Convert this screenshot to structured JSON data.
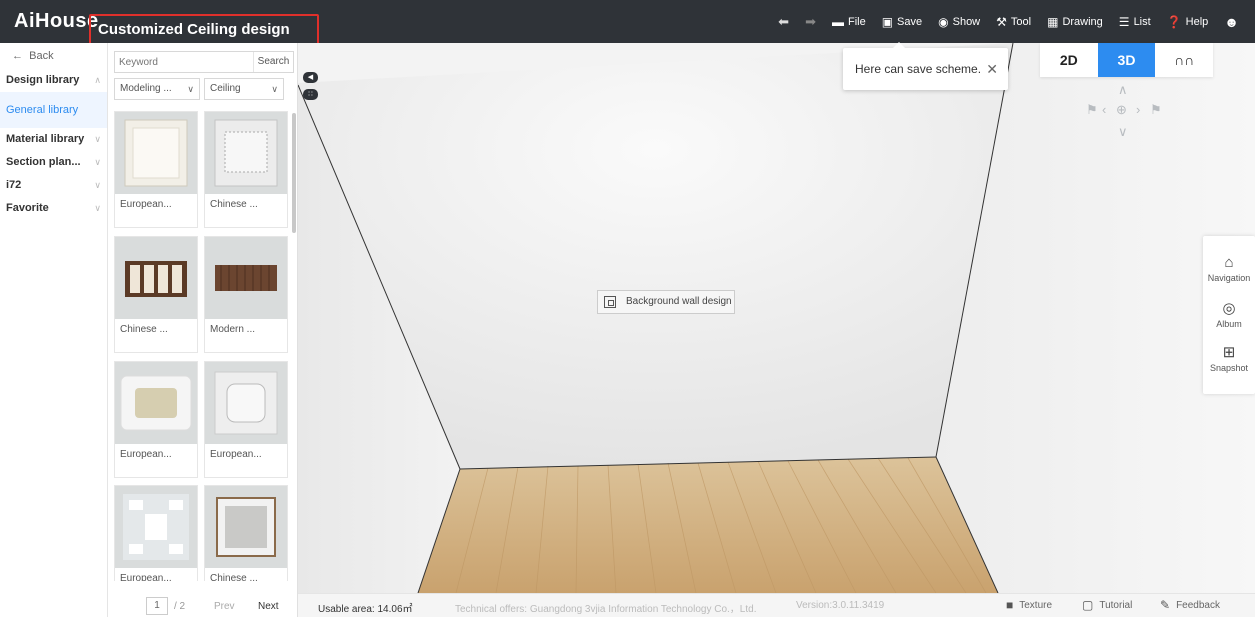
{
  "header": {
    "logo_text": "AiHouse",
    "page_title": "Customized Ceiling design",
    "toolbar": {
      "file": "File",
      "save": "Save",
      "show": "Show",
      "tool": "Tool",
      "drawing": "Drawing",
      "list": "List",
      "help": "Help"
    }
  },
  "sidebar": {
    "back": "Back",
    "design_library": "Design library",
    "general_library": "General library",
    "material_library": "Material library",
    "section_plan": "Section plan...",
    "i72": "i72",
    "favorite": "Favorite"
  },
  "library": {
    "search_placeholder": "Keyword",
    "search_button": "Search",
    "filter_type": "Modeling ...",
    "filter_category": "Ceiling",
    "items": [
      {
        "label": "European..."
      },
      {
        "label": "Chinese ..."
      },
      {
        "label": "Chinese ..."
      },
      {
        "label": "Modern ..."
      },
      {
        "label": "European..."
      },
      {
        "label": "European..."
      },
      {
        "label": "European..."
      },
      {
        "label": "Chinese ..."
      }
    ],
    "pager": {
      "current": "1",
      "total": "/ 2",
      "prev": "Prev",
      "next": "Next"
    }
  },
  "viewport": {
    "tooltip": "Here can save scheme.",
    "view_tabs": [
      "2D",
      "3D",
      "ΩΩ"
    ],
    "active_view": "3D",
    "background_wall_button": "Background wall design"
  },
  "right_panel": {
    "navigation": "Navigation",
    "album": "Album",
    "snapshot": "Snapshot"
  },
  "status_bar": {
    "usable_area": "Usable area: 14.06㎡",
    "technical_offers": "Technical offers: Guangdong 3vjia Information Technology Co.，Ltd.",
    "version": "Version:3.0.11.3419",
    "texture": "Texture",
    "tutorial": "Tutorial",
    "feedback": "Feedback"
  },
  "colors": {
    "topbar": "#2f3338",
    "accent": "#2d8cf0",
    "highlight_box": "#e0302b",
    "floor": "#d9b88a"
  }
}
